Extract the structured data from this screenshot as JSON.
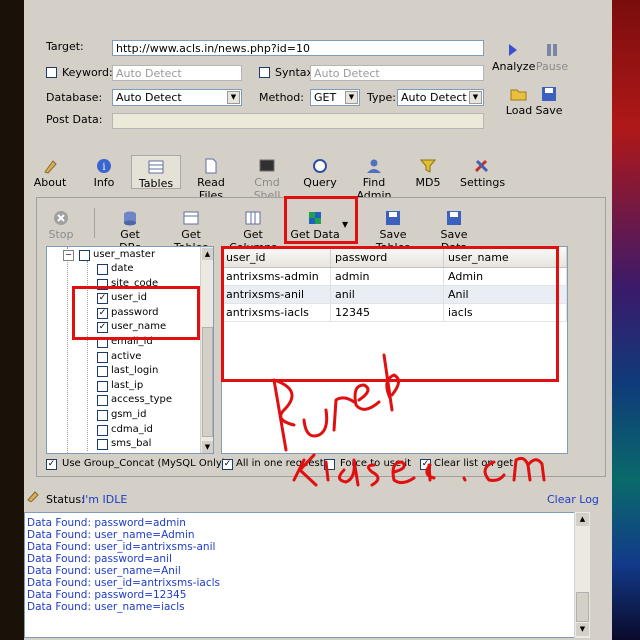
{
  "form": {
    "target_label": "Target:",
    "target_value": "http://www.acls.in/news.php?id=10",
    "keyword_label": "Keyword:",
    "keyword_placeholder": "Auto Detect",
    "syntax_label": "Syntax:",
    "syntax_placeholder": "Auto Detect",
    "database_label": "Database:",
    "database_value": "Auto Detect",
    "method_label": "Method:",
    "method_value": "GET",
    "type_label": "Type:",
    "type_value": "Auto Detect",
    "postdata_label": "Post Data:"
  },
  "actions": {
    "analyze": "Analyze",
    "pause": "Pause",
    "load": "Load",
    "save": "Save"
  },
  "nav": [
    "About",
    "Info",
    "Tables",
    "Read Files",
    "Cmd Shell",
    "Query",
    "Find Admin",
    "MD5",
    "Settings"
  ],
  "toolbar": [
    "Stop",
    "Get DBs",
    "Get Tables",
    "Get Columns",
    "Get Data",
    "Save Tables",
    "Save Data"
  ],
  "tree": {
    "root": "user_master",
    "items": [
      "date",
      "site_code",
      "user_id",
      "password",
      "user_name",
      "email_id",
      "active",
      "last_login",
      "last_ip",
      "access_type",
      "gsm_id",
      "cdma_id",
      "sms_bal"
    ],
    "checked": [
      false,
      false,
      true,
      true,
      true,
      false,
      false,
      false,
      false,
      false,
      false,
      false,
      false
    ]
  },
  "grid": {
    "headers": [
      "user_id",
      "password",
      "user_name"
    ],
    "rows": [
      [
        "antrixsms-admin",
        "admin",
        "Admin"
      ],
      [
        "antrixsms-anil",
        "anil",
        "Anil"
      ],
      [
        "antrixsms-iacls",
        "12345",
        "iacls"
      ]
    ]
  },
  "options": {
    "group_concat": "Use Group_Concat (MySQL Only)",
    "all_in_one": "All in one request",
    "force": "Force to use it",
    "clear_list": "Clear list on get"
  },
  "status": {
    "label": "Status:",
    "value": "I'm IDLE",
    "clear_log": "Clear Log"
  },
  "log": [
    "Data Found: password=admin",
    "Data Found: user_name=Admin",
    "Data Found: user_id=antrixsms-anil",
    "Data Found: password=anil",
    "Data Found: user_name=Anil",
    "Data Found: user_id=antrixsms-iacls",
    "Data Found: password=12345",
    "Data Found: user_name=iacls"
  ],
  "colors": {
    "accent_red": "#e01010",
    "log_blue": "#1e3cc8",
    "link_blue": "#1e3cc8"
  }
}
